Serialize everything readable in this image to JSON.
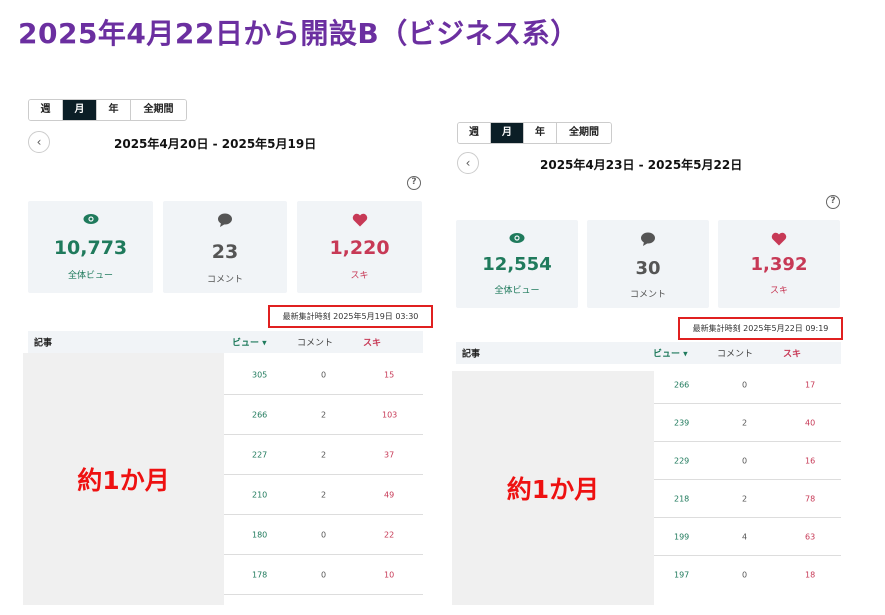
{
  "title": "2025年4月22日から開設B（ビジネス系）",
  "left": {
    "tabs": [
      "週",
      "月",
      "年",
      "全期間"
    ],
    "active_tab": "月",
    "date_range": "2025年4月20日 - 2025年5月19日",
    "stats": [
      {
        "icon": "eye-icon",
        "value": "10,773",
        "label": "全体ビュー"
      },
      {
        "icon": "comment-icon",
        "value": "23",
        "label": "コメント"
      },
      {
        "icon": "heart-icon",
        "value": "1,220",
        "label": "スキ"
      }
    ],
    "last_aggregated": "最新集計時刻 2025年5月19日 03:30",
    "table_headers": {
      "article": "記事",
      "views": "ビュー ▾",
      "comments": "コメント",
      "likes": "スキ"
    },
    "overlay_label": "約1か月",
    "rows": [
      {
        "views": "305",
        "comments": "0",
        "likes": "15"
      },
      {
        "views": "266",
        "comments": "2",
        "likes": "103"
      },
      {
        "views": "227",
        "comments": "2",
        "likes": "37"
      },
      {
        "views": "210",
        "comments": "2",
        "likes": "49"
      },
      {
        "views": "180",
        "comments": "0",
        "likes": "22"
      },
      {
        "views": "178",
        "comments": "0",
        "likes": "10"
      }
    ]
  },
  "right": {
    "tabs": [
      "週",
      "月",
      "年",
      "全期間"
    ],
    "active_tab": "月",
    "date_range": "2025年4月23日 - 2025年5月22日",
    "stats": [
      {
        "icon": "eye-icon",
        "value": "12,554",
        "label": "全体ビュー"
      },
      {
        "icon": "comment-icon",
        "value": "30",
        "label": "コメント"
      },
      {
        "icon": "heart-icon",
        "value": "1,392",
        "label": "スキ"
      }
    ],
    "last_aggregated": "最新集計時刻 2025年5月22日 09:19",
    "table_headers": {
      "article": "記事",
      "views": "ビュー ▾",
      "comments": "コメント",
      "likes": "スキ"
    },
    "overlay_label": "約1か月",
    "rows": [
      {
        "views": "266",
        "comments": "0",
        "likes": "17"
      },
      {
        "views": "239",
        "comments": "2",
        "likes": "40"
      },
      {
        "views": "229",
        "comments": "0",
        "likes": "16"
      },
      {
        "views": "218",
        "comments": "2",
        "likes": "78"
      },
      {
        "views": "199",
        "comments": "4",
        "likes": "63"
      },
      {
        "views": "197",
        "comments": "0",
        "likes": "18"
      }
    ]
  },
  "colors": {
    "title": "#6b2fa0",
    "views": "#1f7a5c",
    "likes": "#c73956",
    "highlight_box": "#e02020",
    "active_tab": "#0b1e26"
  }
}
